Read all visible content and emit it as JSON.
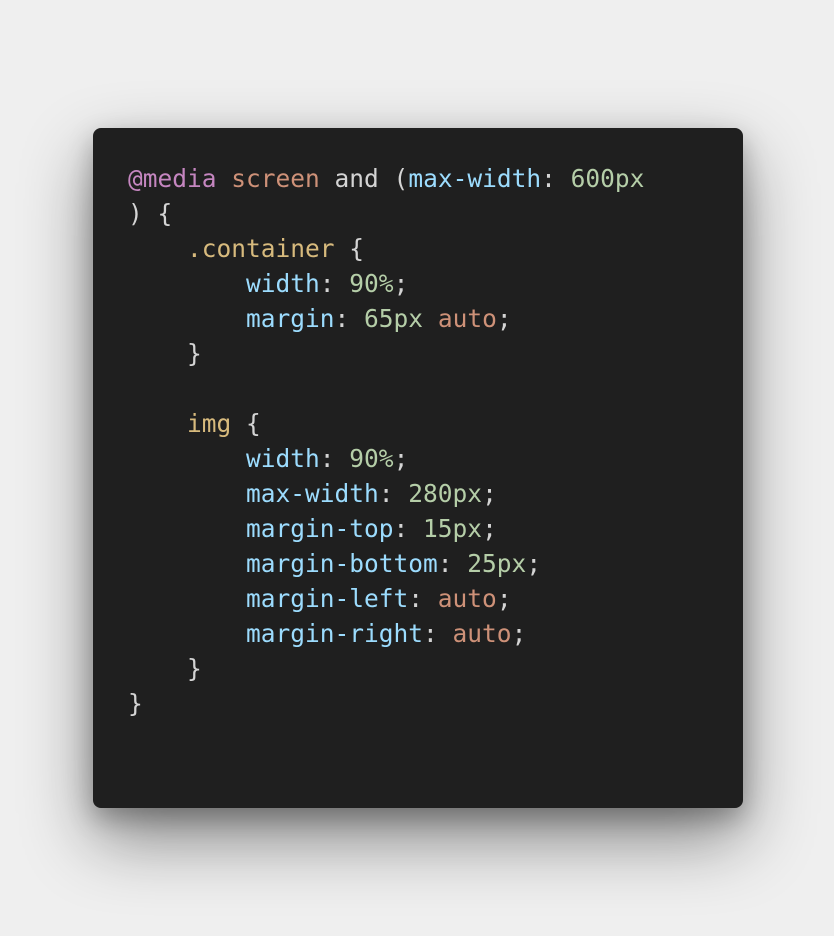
{
  "colors": {
    "page_background": "#efefef",
    "editor_background": "#1f1f1f",
    "at_rule": "#c586c0",
    "keyword_value": "#ce9178",
    "plain_text": "#d4d4d4",
    "property": "#9cdcfe",
    "number": "#b5cea8",
    "selector": "#d7ba7d"
  },
  "code": {
    "language": "css",
    "lines": [
      [
        {
          "t": "at",
          "v": "@media"
        },
        {
          "t": "text",
          "v": " "
        },
        {
          "t": "kw",
          "v": "screen"
        },
        {
          "t": "text",
          "v": " and ("
        },
        {
          "t": "prop",
          "v": "max-width"
        },
        {
          "t": "punct",
          "v": ": "
        },
        {
          "t": "num",
          "v": "600px"
        }
      ],
      [
        {
          "t": "punct",
          "v": ") {"
        }
      ],
      [
        {
          "t": "text",
          "v": "    "
        },
        {
          "t": "sel",
          "v": ".container"
        },
        {
          "t": "punct",
          "v": " {"
        }
      ],
      [
        {
          "t": "text",
          "v": "        "
        },
        {
          "t": "prop",
          "v": "width"
        },
        {
          "t": "punct",
          "v": ": "
        },
        {
          "t": "num",
          "v": "90%"
        },
        {
          "t": "punct",
          "v": ";"
        }
      ],
      [
        {
          "t": "text",
          "v": "        "
        },
        {
          "t": "prop",
          "v": "margin"
        },
        {
          "t": "punct",
          "v": ": "
        },
        {
          "t": "num",
          "v": "65px"
        },
        {
          "t": "text",
          "v": " "
        },
        {
          "t": "kw",
          "v": "auto"
        },
        {
          "t": "punct",
          "v": ";"
        }
      ],
      [
        {
          "t": "text",
          "v": "    "
        },
        {
          "t": "punct",
          "v": "}"
        }
      ],
      [],
      [
        {
          "t": "text",
          "v": "    "
        },
        {
          "t": "sel",
          "v": "img"
        },
        {
          "t": "punct",
          "v": " {"
        }
      ],
      [
        {
          "t": "text",
          "v": "        "
        },
        {
          "t": "prop",
          "v": "width"
        },
        {
          "t": "punct",
          "v": ": "
        },
        {
          "t": "num",
          "v": "90%"
        },
        {
          "t": "punct",
          "v": ";"
        }
      ],
      [
        {
          "t": "text",
          "v": "        "
        },
        {
          "t": "prop",
          "v": "max-width"
        },
        {
          "t": "punct",
          "v": ": "
        },
        {
          "t": "num",
          "v": "280px"
        },
        {
          "t": "punct",
          "v": ";"
        }
      ],
      [
        {
          "t": "text",
          "v": "        "
        },
        {
          "t": "prop",
          "v": "margin-top"
        },
        {
          "t": "punct",
          "v": ": "
        },
        {
          "t": "num",
          "v": "15px"
        },
        {
          "t": "punct",
          "v": ";"
        }
      ],
      [
        {
          "t": "text",
          "v": "        "
        },
        {
          "t": "prop",
          "v": "margin-bottom"
        },
        {
          "t": "punct",
          "v": ": "
        },
        {
          "t": "num",
          "v": "25px"
        },
        {
          "t": "punct",
          "v": ";"
        }
      ],
      [
        {
          "t": "text",
          "v": "        "
        },
        {
          "t": "prop",
          "v": "margin-left"
        },
        {
          "t": "punct",
          "v": ": "
        },
        {
          "t": "kw",
          "v": "auto"
        },
        {
          "t": "punct",
          "v": ";"
        }
      ],
      [
        {
          "t": "text",
          "v": "        "
        },
        {
          "t": "prop",
          "v": "margin-right"
        },
        {
          "t": "punct",
          "v": ": "
        },
        {
          "t": "kw",
          "v": "auto"
        },
        {
          "t": "punct",
          "v": ";"
        }
      ],
      [
        {
          "t": "text",
          "v": "    "
        },
        {
          "t": "punct",
          "v": "}"
        }
      ],
      [
        {
          "t": "punct",
          "v": "}"
        }
      ]
    ]
  }
}
